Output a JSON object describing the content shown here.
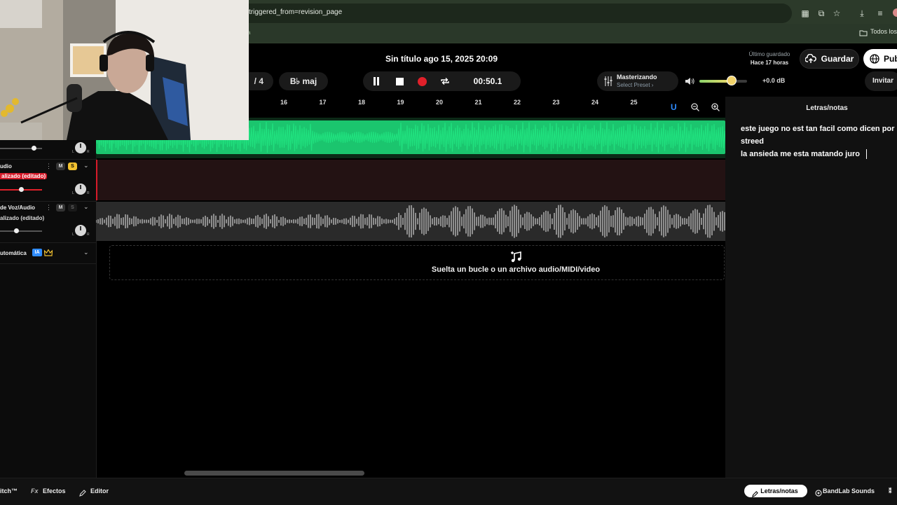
{
  "browser": {
    "url": "triggered_from=revision_page",
    "bookmark_all": "Todos los",
    "bookmark_fragment": "a"
  },
  "header": {
    "project_title": "Sin título ago 15, 2025 20:09",
    "last_saved_label": "Último guardado",
    "last_saved_time": "Hace 17 horas",
    "save_label": "Guardar",
    "publish_label": "Pub"
  },
  "transport": {
    "time_signature": "/ 4",
    "key": "B♭ maj",
    "time": "00:50.1",
    "mastering_label": "Masterizando",
    "preset_label": "Select Preset ›",
    "master_volume_db": "+0.0 dB",
    "master_volume_level": 0.68,
    "invite_label": "Invitar"
  },
  "ruler": {
    "bars": [
      "16",
      "17",
      "18",
      "19",
      "20",
      "21",
      "22",
      "23",
      "24",
      "25"
    ]
  },
  "tracks": [
    {
      "name": "",
      "sub": ""
    },
    {
      "name": "udio",
      "sub": "alizado (editado)",
      "mute": "M",
      "solo": "S"
    },
    {
      "name": "de Voz/Audio",
      "sub": "alizado (editado)",
      "mute": "M",
      "solo": "S"
    },
    {
      "name": "utomática",
      "badge": "IA"
    }
  ],
  "drop_zone": {
    "text": "Suelta un bucle o un archivo audio/MIDI/video"
  },
  "lyrics": {
    "title": "Letras/notas",
    "lines": [
      "este juego no est tan facil como dicen por",
      "streed",
      "la ansieda me esta matando juro"
    ]
  },
  "bottom_bar": {
    "switch_label": "itch™",
    "effects_label": "Efectos",
    "editor_label": "Editor",
    "lyrics_tab": "Letras/notas",
    "sounds_label": "BandLab Sounds"
  },
  "colors": {
    "accent_green": "#1fd87a",
    "record_red": "#e0202a",
    "solo_yellow": "#f2c230",
    "ia_badge": "#2f8cff"
  }
}
